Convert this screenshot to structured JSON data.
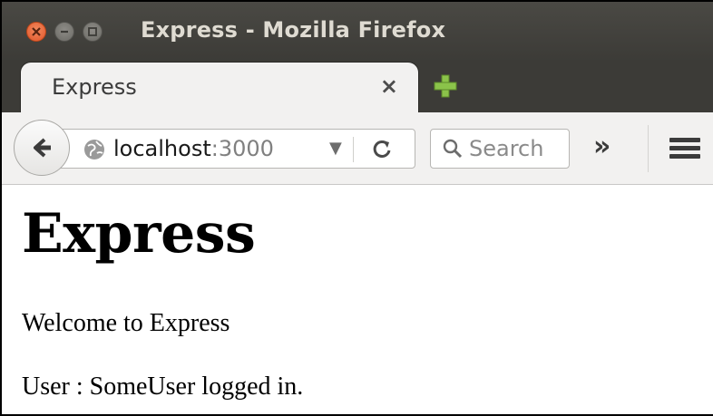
{
  "window": {
    "title": "Express - Mozilla Firefox"
  },
  "tabs": [
    {
      "label": "Express",
      "close_glyph": "×"
    }
  ],
  "navbar": {
    "url_host": "localhost",
    "url_port": ":3000",
    "search_placeholder": "Search",
    "overflow_glyph": "»"
  },
  "icons": {
    "close": "close-icon",
    "minimize": "minimize-icon",
    "maximize": "maximize-icon",
    "new_tab": "plus-icon",
    "back": "back-arrow-icon",
    "site_identity": "globe-icon",
    "url_dropdown": "chevron-down-icon",
    "reload": "reload-icon",
    "search": "search-icon",
    "menu": "hamburger-menu-icon"
  },
  "colors": {
    "titlebar": "#3c3b37",
    "close_button": "#e0552a",
    "new_tab_plus": "#8bc34a"
  },
  "page": {
    "heading": "Express",
    "welcome": "Welcome to Express",
    "user_status": "User : SomeUser logged in."
  }
}
